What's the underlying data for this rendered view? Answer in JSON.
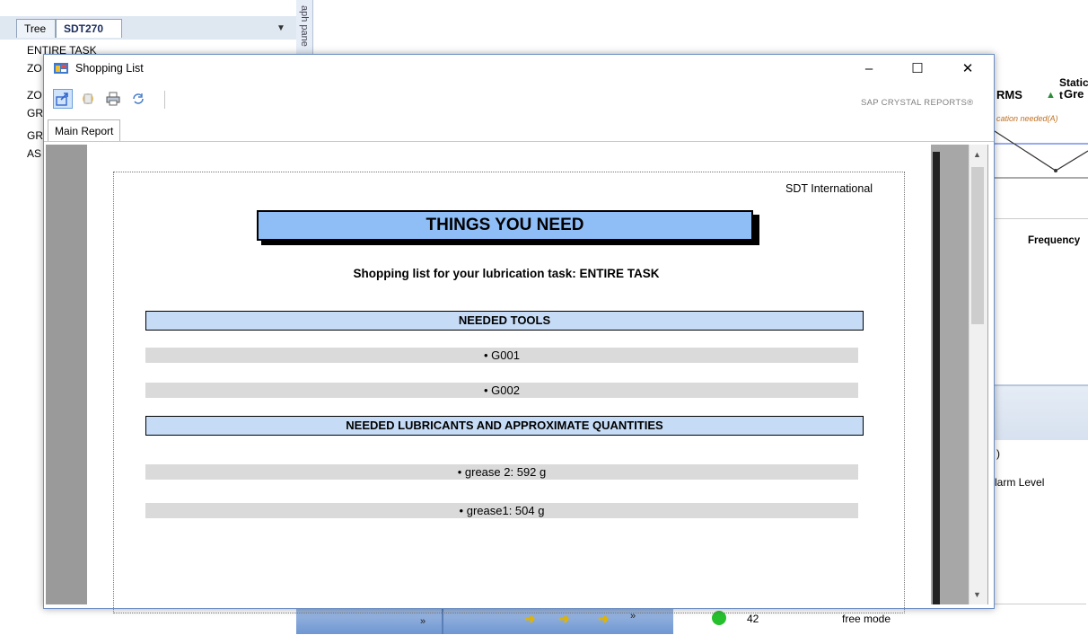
{
  "background": {
    "tabs": [
      "Tree",
      "SDT270"
    ],
    "tree_items": [
      "ENTIRE TASK",
      "ZO",
      "ZO",
      "GR",
      "GR",
      "AS"
    ],
    "side_panel_label": "aph pane",
    "right_panel": {
      "static_label": "Static t",
      "rms": "RMS",
      "gre": "Gre",
      "annotation": "cation needed(A)",
      "frequency": "Frequency",
      "paren": ")",
      "alarm": "larm Level"
    },
    "table_row": {
      "value": "42",
      "mode": "free mode"
    }
  },
  "dialog": {
    "title": "Shopping List",
    "window_buttons": {
      "minimize": "–",
      "maximize": "☐",
      "close": "✕"
    },
    "brand": "SAP CRYSTAL REPORTS®",
    "tab": "Main Report"
  },
  "report": {
    "company": "SDT International",
    "title": "THINGS YOU NEED",
    "subtitle": "Shopping list for your lubrication task: ENTIRE TASK",
    "tools_header": "NEEDED TOOLS",
    "tools": [
      "• G001",
      "• G002"
    ],
    "lubricants_header": "NEEDED LUBRICANTS AND APPROXIMATE QUANTITIES",
    "lubricants": [
      "• grease 2: 592 g",
      "• grease1: 504 g"
    ]
  }
}
